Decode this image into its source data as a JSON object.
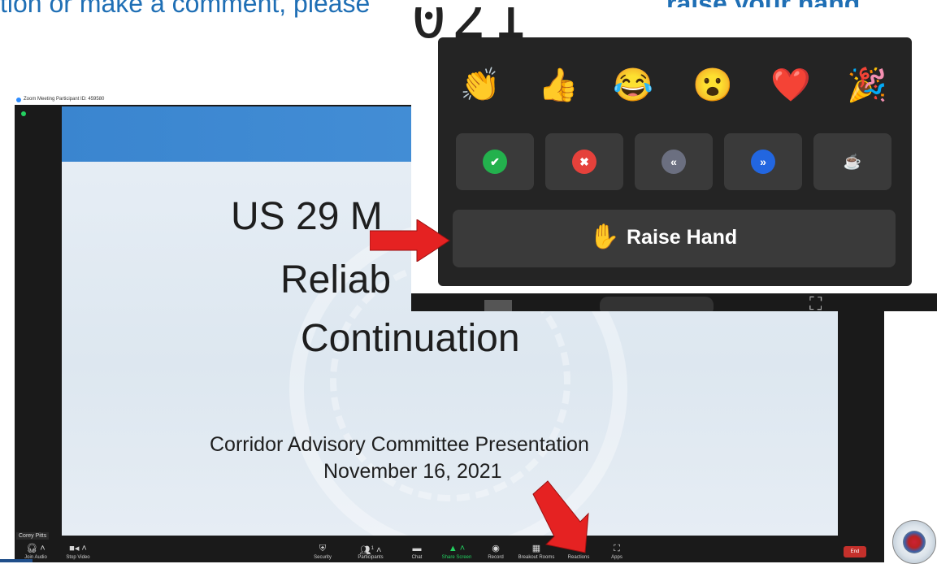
{
  "slide_header": {
    "prefix": "tion or make a comment, please ",
    "bold": "raise your hand"
  },
  "window": {
    "title": "Zoom Meeting Participant ID: 459580"
  },
  "slide": {
    "line1": "US 29 M",
    "line2": "Reliab",
    "line3": "Continuation",
    "line4": "Corridor Advisory Committee Presentation",
    "line5": "November 16, 2021"
  },
  "participant_name": "Corey Pitts",
  "toolbar": {
    "join_audio": "Join Audio",
    "stop_video": "Stop Video",
    "security": "Security",
    "participants": "Participants",
    "participants_count": "1",
    "chat": "Chat",
    "share_screen": "Share Screen",
    "record": "Record",
    "breakout_rooms": "Breakout Rooms",
    "reactions": "Reactions",
    "apps": "Apps",
    "end": "End"
  },
  "reactions_popup": {
    "background_year": "021",
    "emojis": [
      "👏",
      "👍",
      "😂",
      "😮",
      "❤️",
      "🎉"
    ],
    "emoji_names": [
      "clap-icon",
      "thumbs-up-icon",
      "joy-icon",
      "open-mouth-icon",
      "heart-icon",
      "party-popper-icon"
    ],
    "status_buttons": [
      {
        "name": "yes-button",
        "glyph": "✔",
        "color": "#23b14d"
      },
      {
        "name": "no-button",
        "glyph": "✖",
        "color": "#e5413b"
      },
      {
        "name": "slow-down-button",
        "glyph": "«",
        "color": "#6b6f80"
      },
      {
        "name": "speed-up-button",
        "glyph": "»",
        "color": "#2266e0"
      },
      {
        "name": "coffee-button",
        "glyph": "☕",
        "color": "transparent"
      }
    ],
    "raise_hand_icon": "✋",
    "raise_hand_label": "Raise Hand"
  },
  "colors": {
    "arrow": "#e52222",
    "zoom_dark": "#1a1a1a",
    "share_green": "#23d160",
    "end_red": "#c4302b",
    "header_blue": "#1f6fb5"
  }
}
